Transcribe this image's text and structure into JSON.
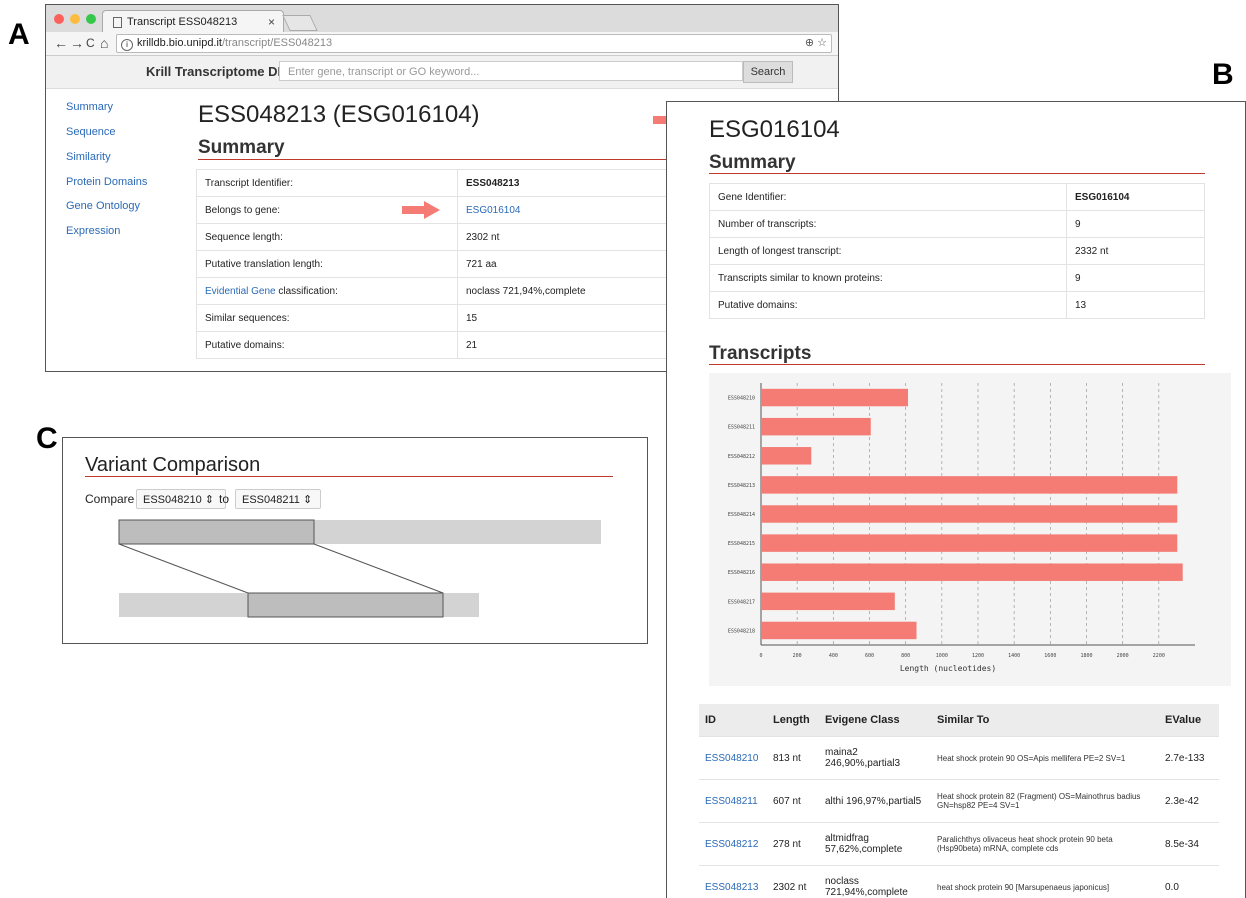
{
  "panel_labels": {
    "a": "A",
    "b": "B",
    "c": "C"
  },
  "browser": {
    "tab_title": "Transcript ESS048213",
    "tab_close": "×",
    "url_host": "krilldb.bio.unipd.it",
    "url_path": "/transcript/ESS048213",
    "nav_back": "←",
    "nav_forward": "→",
    "nav_reload": "C",
    "nav_home": "⌂",
    "info_glyph": "i",
    "zoom_glyph": "⊕ ☆"
  },
  "site": {
    "brand": "Krill Transcriptome DB",
    "search_placeholder": "Enter gene, transcript or GO keyword...",
    "search_button": "Search"
  },
  "panelA": {
    "sidebar": [
      "Summary",
      "Sequence",
      "Similarity",
      "Protein Domains",
      "Gene Ontology",
      "Expression"
    ],
    "title": "ESS048213 (ESG016104)",
    "section": "Summary",
    "rows": [
      {
        "label": "Transcript Identifier:",
        "value": "ESS048213"
      },
      {
        "label": "Belongs to gene:",
        "value": "ESG016104"
      },
      {
        "label": "Sequence length:",
        "value": "2302 nt"
      },
      {
        "label": "Putative translation length:",
        "value": "721 aa"
      },
      {
        "label_link": "Evidential Gene",
        "label_rest": " classification:",
        "value": "noclass 721,94%,complete"
      },
      {
        "label": "Similar sequences:",
        "value": "15"
      },
      {
        "label": "Putative domains:",
        "value": "21"
      }
    ]
  },
  "panelB": {
    "title": "ESG016104",
    "section_summary": "Summary",
    "rows": [
      {
        "label": "Gene Identifier:",
        "value": "ESG016104"
      },
      {
        "label": "Number of transcripts:",
        "value": "9"
      },
      {
        "label": "Length of longest transcript:",
        "value": "2332 nt"
      },
      {
        "label": "Transcripts similar to known proteins:",
        "value": "9"
      },
      {
        "label": "Putative domains:",
        "value": "13"
      }
    ],
    "section_transcripts": "Transcripts",
    "table_headers": [
      "ID",
      "Length",
      "Evigene Class",
      "Similar To",
      "EValue"
    ],
    "table_rows": [
      {
        "id": "ESS048210",
        "length": "813 nt",
        "class": "maina2 246,90%,partial3",
        "similar": "Heat shock protein 90 OS=Apis mellifera PE=2 SV=1",
        "evalue": "2.7e-133"
      },
      {
        "id": "ESS048211",
        "length": "607 nt",
        "class": "althi 196,97%,partial5",
        "similar": "Heat shock protein 82 (Fragment) OS=Mainothrus badius GN=hsp82 PE=4 SV=1",
        "evalue": "2.3e-42"
      },
      {
        "id": "ESS048212",
        "length": "278 nt",
        "class": "altmidfrag 57,62%,complete",
        "similar": "Paralichthys olivaceus heat shock protein 90 beta (Hsp90beta) mRNA, complete cds",
        "evalue": "8.5e-34"
      },
      {
        "id": "ESS048213",
        "length": "2302 nt",
        "class": "noclass 721,94%,complete",
        "similar": "heat shock protein 90 [Marsupenaeus japonicus]",
        "evalue": "0.0"
      }
    ]
  },
  "chart_data": {
    "type": "bar",
    "orientation": "horizontal",
    "categories": [
      "ESS048210",
      "ESS048211",
      "ESS048212",
      "ESS048213",
      "ESS048214",
      "ESS048215",
      "ESS048216",
      "ESS048217",
      "ESS048218"
    ],
    "values": [
      813,
      607,
      278,
      2302,
      2302,
      2302,
      2332,
      740,
      860
    ],
    "xlabel": "Length (nucleotides)",
    "ylabel": "",
    "xlim": [
      0,
      2400
    ],
    "xticks": [
      0,
      200,
      400,
      600,
      800,
      1000,
      1200,
      1400,
      1600,
      1800,
      2000,
      2200
    ],
    "grid": true,
    "bar_color": "#f47c74"
  },
  "panelC": {
    "title": "Variant Comparison",
    "compare_label": "Compare",
    "select_a": "ESS048210",
    "to_label": "to",
    "select_b": "ESS048211",
    "select_glyph": "⇕"
  },
  "colors": {
    "link": "#2a6ab7",
    "accent_rule": "#c0392b",
    "arrow": "#f47c74"
  }
}
